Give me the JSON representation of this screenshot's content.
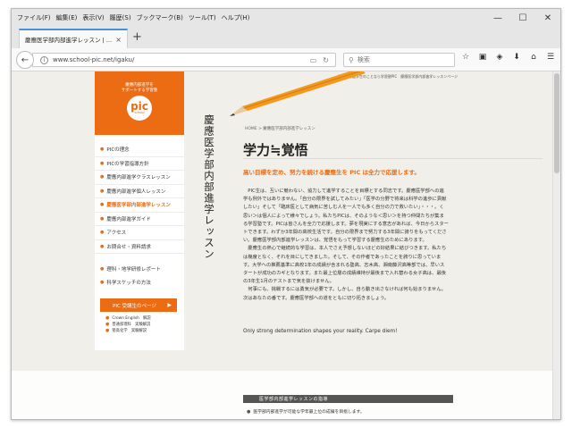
{
  "browser": {
    "menu": [
      "ファイル(F)",
      "編集(E)",
      "表示(V)",
      "履歴(S)",
      "ブックマーク(B)",
      "ツール(T)",
      "ヘルプ(H)"
    ],
    "window_controls": {
      "minimize": "—",
      "maximize": "☐",
      "close": "✕"
    },
    "tab": {
      "title": "慶應医学部内部進学レッスン | ...",
      "close": "×"
    },
    "new_tab": "+",
    "url": "www.school-pic.net/igaku/",
    "search_placeholder": "検索",
    "icons": [
      "star-icon",
      "clipboard-icon",
      "pocket-icon",
      "download-icon",
      "home-icon",
      "menu-icon"
    ]
  },
  "site": {
    "top_note": "慶應内部進学生のことなら学習塾PIC　慶應医学部内部進学レッスンページ",
    "logo": {
      "tagline1": "慶應内部進学を",
      "tagline2": "サポートする学習塾",
      "name": "pic",
      "sub": "school"
    },
    "sidebar": {
      "items": [
        {
          "label": "PICの理念",
          "active": false
        },
        {
          "label": "PICの学習指導方針",
          "active": false
        },
        {
          "label": "慶應内部進学クラスレッスン",
          "active": false
        },
        {
          "label": "慶應内部進学個人レッスン",
          "active": false
        },
        {
          "label": "慶應医学部内部進学レッスン",
          "active": true
        },
        {
          "label": "慶應内部進学ガイド",
          "active": false
        },
        {
          "label": "アクセス",
          "active": false
        },
        {
          "label": "お問合せ・資料請求",
          "active": false
        }
      ],
      "items2": [
        {
          "label": "理科・地学研修レポート"
        },
        {
          "label": "科学スケッチの方法"
        }
      ],
      "button": {
        "label": "PIC 受講生のページ",
        "arrow": "▶"
      },
      "sub_links": [
        "Crown English　解説",
        "普通部理科　実験解説",
        "塾高化学　実験解説"
      ]
    },
    "vertical_title": "慶應医学部内部進学レッスン",
    "breadcrumb": "HOME > 慶應医学部内部進学レッスン",
    "page_title": "学力≒覚悟",
    "lead": "高い目標を定め、努力を続ける慶應生を PIC は全力で応援します。",
    "paragraphs": [
      "PIC生は、互いに競わない、協力して進学することを目標とする同志です。慶應医学部への進学も例外ではありません。「自分の限界を試してみたい」「医学の分野で将来は科学の進歩に貢献したい」そして「臨床医として病気に苦しむ人を一人でも多く自分の力で救いたい」・・・。く思い＞は個人によって様々でしょう。私たちPICは、そのような＜思い＞を持つ仲間たちが集まる学習塾です。PICは皆さんを全力で応援します。夢を現実にする意志があれば、今日からスタートできます。わずか3年間の高校生活です。自分の限界まで努力する3年間に誇りをもってください。慶應医学部内部進学レッスンは、覚悟をもって学習する慶應生のためにあります。",
      "慶應生の熱心で継続的な学習は、本人でさえ予想しないほどの好結果に結びつきます。私たちは幾度となく、それを目にしてきました。そして、その作者であったことを誇りに思っています。大学への推薦基準に高校1年の成績が含まれる塾高、志木高、湘南藤沢高等部では、早いスタートが成功のカギとなります。また最上位層の成績維持が最後まで入れ替わる女子高は、最後の3年生1月のテストまで気を抜けません。",
      "何事にも、挑戦するには勇気が必要です。しかし、自ら動き出さなければ何も始まりません。次はあなたの番です。慶應医学部への道をともに切り拓きましょう。"
    ],
    "english": "Only strong determination shapes your reality.   Carpe diem!",
    "section_header": "医学部内部進学レッスンの指導",
    "section_item": "医学部内部進学が可能な学年最上位の成績を目指します。"
  }
}
